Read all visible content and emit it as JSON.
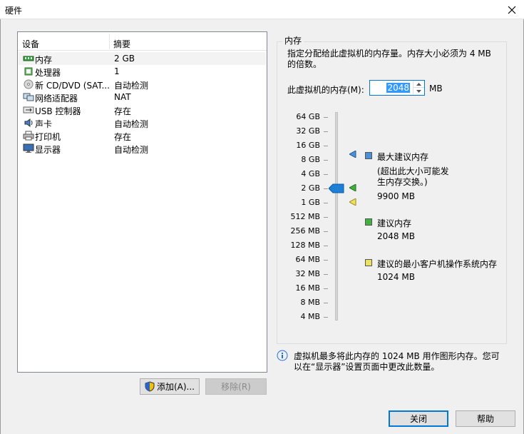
{
  "window": {
    "title": "硬件"
  },
  "device_list": {
    "columns": [
      "设备",
      "摘要"
    ],
    "rows": [
      {
        "name": "内存",
        "summary": "2 GB",
        "icon": "memory-icon"
      },
      {
        "name": "处理器",
        "summary": "1",
        "icon": "processor-icon"
      },
      {
        "name": "新 CD/DVD (SAT...",
        "summary": "自动检测",
        "icon": "cd-dvd-icon"
      },
      {
        "name": "网络适配器",
        "summary": "NAT",
        "icon": "network-adapter-icon"
      },
      {
        "name": "USB 控制器",
        "summary": "存在",
        "icon": "usb-icon"
      },
      {
        "name": "声卡",
        "summary": "自动检测",
        "icon": "sound-card-icon"
      },
      {
        "name": "打印机",
        "summary": "存在",
        "icon": "printer-icon"
      },
      {
        "name": "显示器",
        "summary": "自动检测",
        "icon": "display-icon"
      }
    ],
    "selected": "内存"
  },
  "buttons": {
    "add": "添加(A)...",
    "remove": "移除(R)",
    "close": "关闭",
    "help": "帮助"
  },
  "memory": {
    "group_title": "内存",
    "description": "指定分配给此虚拟机的内存量。内存大小必须为 4 MB 的倍数。",
    "field_label": "此虚拟机的内存(M):",
    "value": "2048",
    "unit": "MB",
    "scale_ticks": [
      "64 GB",
      "32 GB",
      "16 GB",
      "8 GB",
      "4 GB",
      "2 GB",
      "1 GB",
      "512 MB",
      "256 MB",
      "128 MB",
      "64 MB",
      "32 MB",
      "16 MB",
      "8 MB",
      "4 MB"
    ],
    "legend": {
      "max_label": "最大建议内存",
      "max_note": "(超出此大小可能发生内存交换。)",
      "max_value": "9900 MB",
      "recommended_label": "建议内存",
      "recommended_value": "2048 MB",
      "min_label": "建议的最小客户机操作系统内存",
      "min_value": "1024 MB"
    },
    "info_text": "虚拟机最多将此内存的 1024 MB 用作图形内存。您可以在“显示器”设置页面中更改此数量。"
  },
  "colors": {
    "accent": "#0078d7",
    "max_marker": "#4a90d9",
    "recommended_marker": "#3fb13f",
    "min_marker": "#f0e060"
  }
}
